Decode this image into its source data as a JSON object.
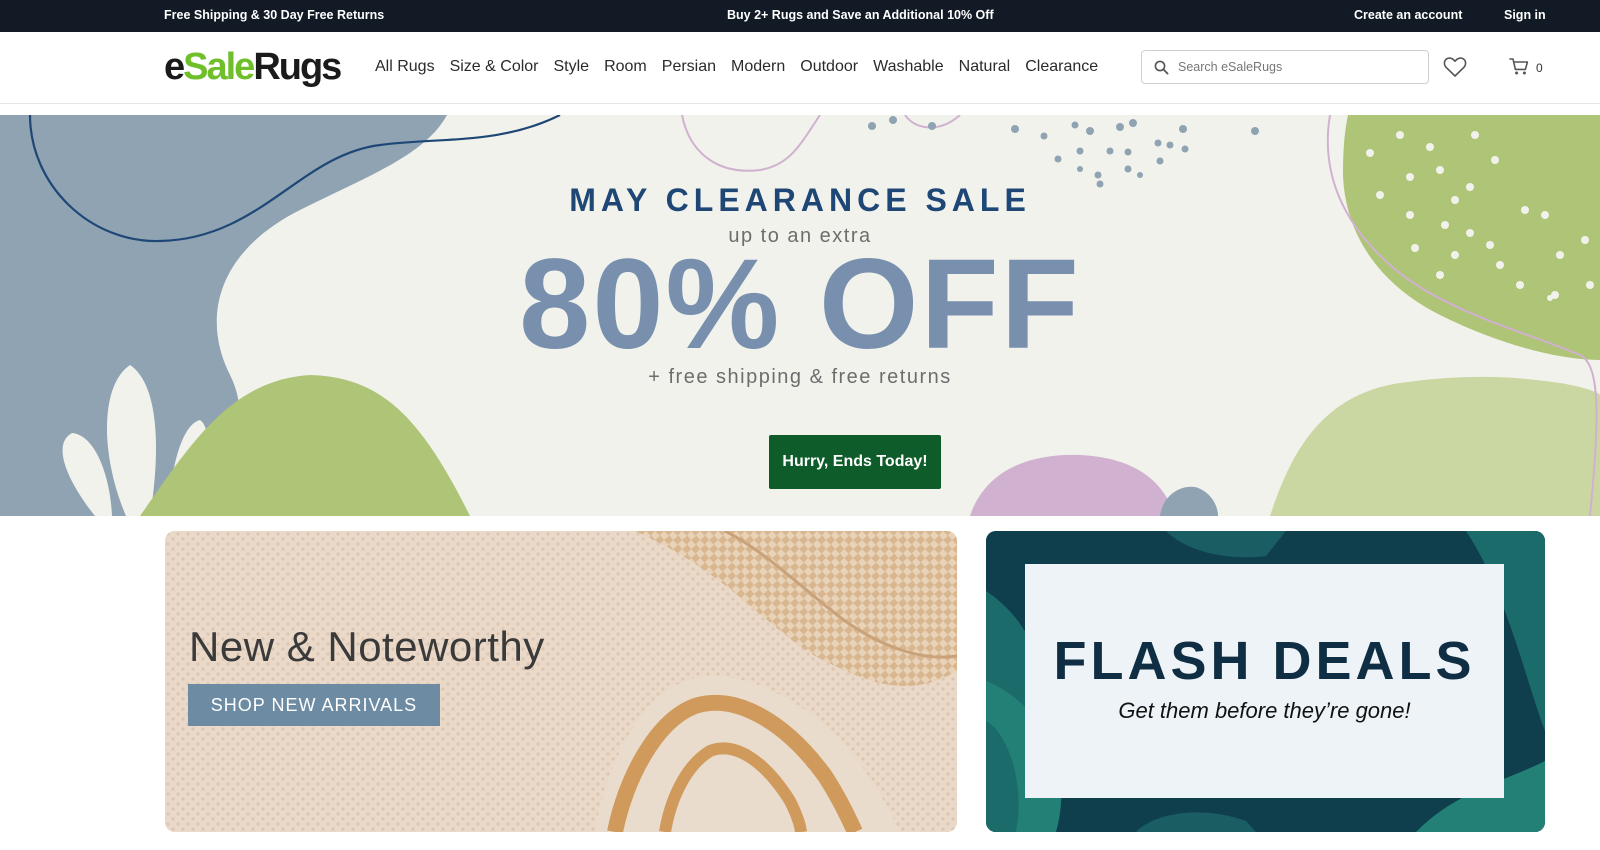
{
  "topbar": {
    "left_text": "Free Shipping & 30 Day Free Returns",
    "center_text": "Buy 2+ Rugs and Save an Additional 10% Off",
    "create_account": "Create an account",
    "sign_in": "Sign in"
  },
  "header": {
    "logo": {
      "e": "e",
      "sale": "Sale",
      "rugs": "Rugs"
    },
    "nav": [
      "All Rugs",
      "Size & Color",
      "Style",
      "Room",
      "Persian",
      "Modern",
      "Outdoor",
      "Washable",
      "Natural",
      "Clearance"
    ],
    "search": {
      "placeholder": "Search eSaleRugs",
      "value": "",
      "icon": "search-icon"
    },
    "wishlist_icon": "heart-icon",
    "cart": {
      "icon": "cart-icon",
      "count": "0"
    }
  },
  "hero": {
    "title": "MAY CLEARANCE SALE",
    "subtitle": "up to an extra",
    "big_text": "80% OFF",
    "shipping_text": "+ free shipping & free returns",
    "button": "Hurry, Ends Today!"
  },
  "promos": {
    "new": {
      "title": "New & Noteworthy",
      "button": "SHOP NEW ARRIVALS"
    },
    "flash": {
      "title": "FLASH DEALS",
      "subtitle": "Get them before they’re gone!"
    }
  },
  "colors": {
    "topbar_bg": "#121a26",
    "hero_bg": "#f2f2ed",
    "hero_title": "#1f4776",
    "hero_big": "#7890ad",
    "cta_green": "#0e5c2a",
    "blob_blue": "#8fa3b3",
    "blob_green": "#aec477",
    "blob_lilac": "#d0b1cf",
    "new_btn": "#6d8ca3",
    "flash_bg": "#0f3f4c"
  }
}
